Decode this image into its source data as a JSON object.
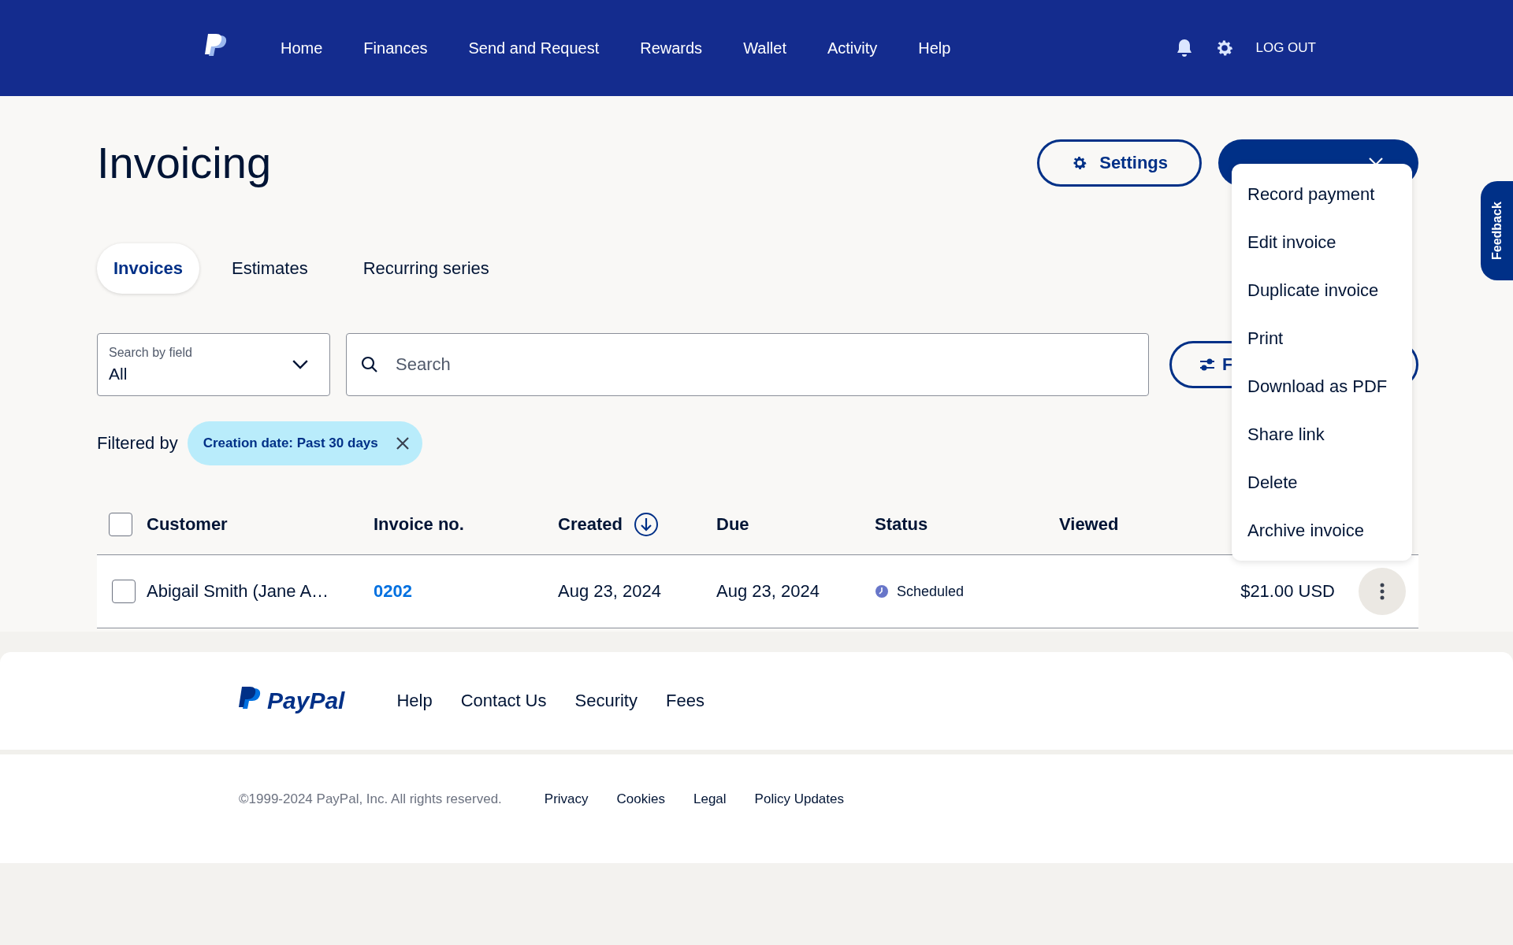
{
  "nav": {
    "items": [
      {
        "label": "Home"
      },
      {
        "label": "Finances"
      },
      {
        "label": "Send and Request"
      },
      {
        "label": "Rewards"
      },
      {
        "label": "Wallet"
      },
      {
        "label": "Activity"
      },
      {
        "label": "Help"
      }
    ],
    "logout": "LOG OUT"
  },
  "header": {
    "title": "Invoicing",
    "settings": "Settings"
  },
  "menu": {
    "items": [
      "Record payment",
      "Edit invoice",
      "Duplicate invoice",
      "Print",
      "Download as PDF",
      "Share link",
      "Delete",
      "Archive invoice"
    ]
  },
  "feedback": "Feedback",
  "tabs": [
    {
      "label": "Invoices",
      "selected": true
    },
    {
      "label": "Estimates",
      "selected": false
    },
    {
      "label": "Recurring series",
      "selected": false
    }
  ],
  "search_by_field": {
    "label": "Search by field",
    "value": "All"
  },
  "search": {
    "placeholder": "Search"
  },
  "filter_button": "F",
  "filters": {
    "label": "Filtered by",
    "chips": [
      "Creation date: Past 30 days"
    ]
  },
  "table": {
    "select_all_checked": false,
    "columns": [
      {
        "label": "Customer",
        "sorted": false
      },
      {
        "label": "Invoice no.",
        "sorted": false
      },
      {
        "label": "Created",
        "sorted": true
      },
      {
        "label": "Due",
        "sorted": false
      },
      {
        "label": "Status",
        "sorted": false
      },
      {
        "label": "Viewed",
        "sorted": false
      }
    ],
    "rows": [
      {
        "checked": false,
        "customer": "Abigail Smith (Jane A…",
        "invoice_no": "0202",
        "created": "Aug 23, 2024",
        "due": "Aug 23, 2024",
        "status": "Scheduled",
        "amount": "$21.00 USD"
      }
    ]
  },
  "footer": {
    "logo": "PayPal",
    "links": [
      "Help",
      "Contact Us",
      "Security",
      "Fees"
    ],
    "copyright": "©1999-2024 PayPal, Inc. All rights reserved.",
    "legal_links": [
      "Privacy",
      "Cookies",
      "Legal",
      "Policy Updates"
    ]
  }
}
